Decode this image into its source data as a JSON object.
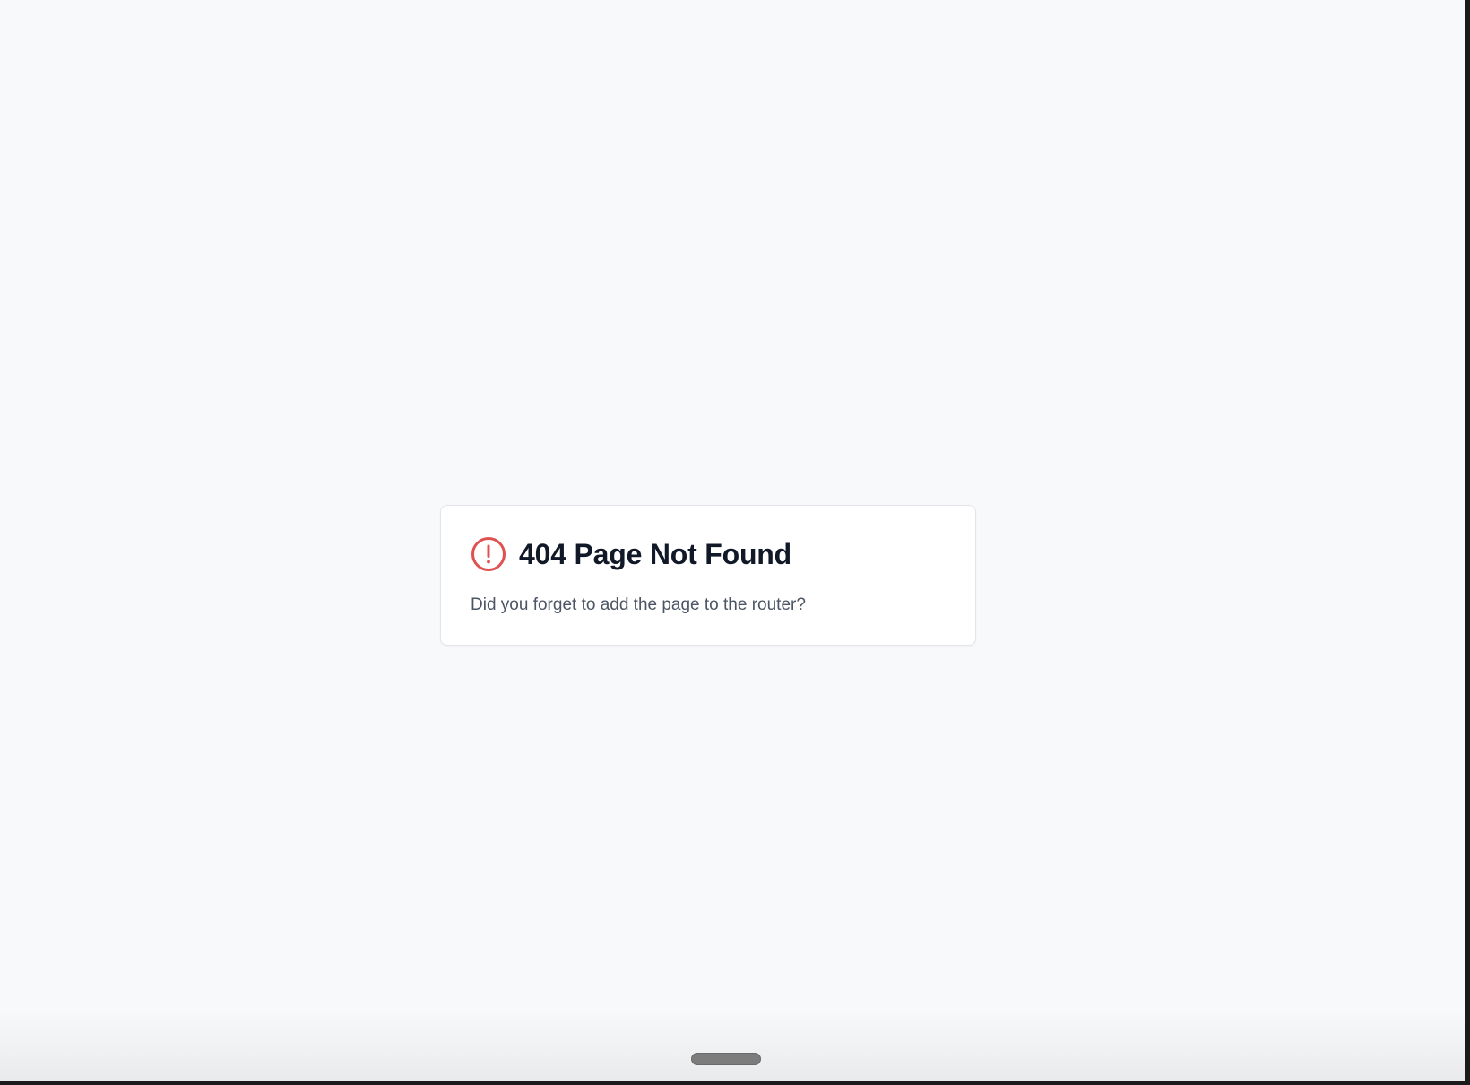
{
  "error_card": {
    "icon": "alert-circle-icon",
    "title": "404 Page Not Found",
    "message": "Did you forget to add the page to the router?"
  },
  "colors": {
    "background": "#f8f9fb",
    "card_background": "#ffffff",
    "title_text": "#111827",
    "message_text": "#4b5563",
    "alert_accent": "#ef4444"
  }
}
